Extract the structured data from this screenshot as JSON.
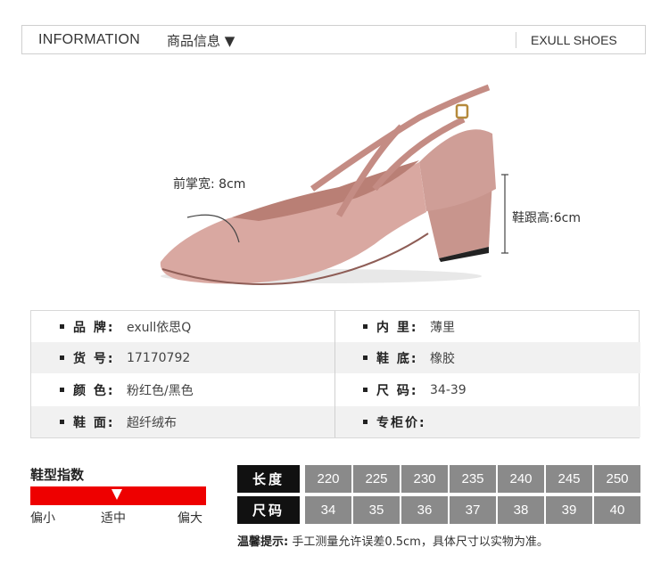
{
  "header": {
    "title_en": "INFORMATION",
    "title_cn": "商品信息 ▼",
    "brand": "EXULL SHOES"
  },
  "shoe": {
    "forefoot_label": "前掌宽: 8cm",
    "heel_label": "鞋跟高:6cm",
    "color": "#d4a39c"
  },
  "specs": {
    "rows": [
      {
        "left_key": "品 牌:",
        "left_val": "exull依思Q",
        "right_key": "内 里:",
        "right_val": "薄里"
      },
      {
        "left_key": "货 号:",
        "left_val": "17170792",
        "right_key": "鞋 底:",
        "right_val": "橡胶"
      },
      {
        "left_key": "颜 色:",
        "left_val": "粉红色/黑色",
        "right_key": "尺 码:",
        "right_val": "34-39"
      },
      {
        "left_key": "鞋 面:",
        "left_val": "超纤绒布",
        "right_key": "专柜价:",
        "right_val": ""
      }
    ]
  },
  "fit": {
    "title": "鞋型指数",
    "low": "偏小",
    "mid": "适中",
    "high": "偏大",
    "accent": "#ee0000"
  },
  "size_table": {
    "length_label": "长度",
    "size_label": "尺码",
    "lengths": [
      "220",
      "225",
      "230",
      "235",
      "240",
      "245",
      "250"
    ],
    "sizes": [
      "34",
      "35",
      "36",
      "37",
      "38",
      "39",
      "40"
    ]
  },
  "tip": {
    "label": "温馨提示:",
    "text": "手工测量允许误差0.5cm，具体尺寸以实物为准。"
  }
}
